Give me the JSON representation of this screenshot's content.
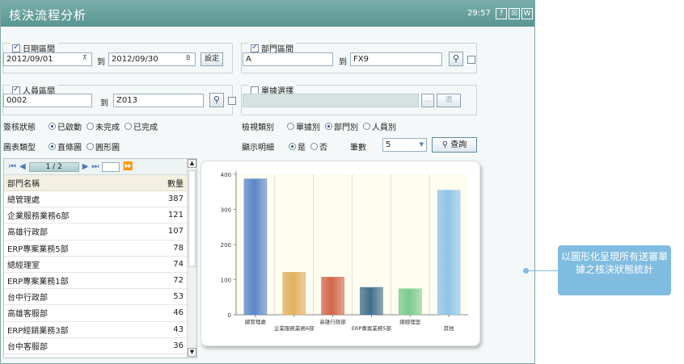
{
  "window": {
    "title": "核決流程分析",
    "clock": "29:57",
    "buttons": [
      "?",
      "☒",
      "W"
    ]
  },
  "date_range": {
    "label": "日期區間",
    "from": "2012/09/01",
    "to_label": "到",
    "to": "2012/09/30",
    "set_label": "設定"
  },
  "dept_range": {
    "label": "部門區間",
    "from": "A",
    "to_label": "到",
    "to": "FX9"
  },
  "person_range": {
    "label": "人員區間",
    "from": "0002",
    "to_label": "到",
    "to": "Z013"
  },
  "form_select": {
    "label": "單據選擇",
    "clear_label": "清"
  },
  "review_status": {
    "label": "簽核狀態",
    "options": [
      "已啟動",
      "未完成",
      "已完成"
    ],
    "selected": 0
  },
  "view_type": {
    "label": "檢視類別",
    "options": [
      "單據別",
      "部門別",
      "人員別"
    ],
    "selected": 1
  },
  "chart_type": {
    "label": "圖表類型",
    "options": [
      "直條圖",
      "圓形圖"
    ],
    "selected": 0
  },
  "show_detail": {
    "label": "顯示明細",
    "options": [
      "是",
      "否"
    ],
    "selected": 0,
    "count_label": "筆數",
    "count_value": "5",
    "query_label": "查詢"
  },
  "grid": {
    "page": "1 / 2",
    "columns": [
      "部門名稱",
      "數量"
    ],
    "rows": [
      [
        "總管理處",
        "387"
      ],
      [
        "企業服務業務6部",
        "121"
      ],
      [
        "高雄行政部",
        "107"
      ],
      [
        "ERP專案業務5部",
        "78"
      ],
      [
        "總經理室",
        "74"
      ],
      [
        "ERP專案業務1部",
        "72"
      ],
      [
        "台中行政部",
        "53"
      ],
      [
        "高雄客服部",
        "46"
      ],
      [
        "ERP經銷業務3部",
        "43"
      ],
      [
        "台中客服部",
        "36"
      ]
    ]
  },
  "chart_data": {
    "type": "bar",
    "categories": [
      "總管理處",
      "企業服務業務6部",
      "高雄行政部",
      "ERP專案業務5部",
      "總經理室",
      "其他"
    ],
    "values": [
      387,
      121,
      107,
      78,
      74,
      355
    ],
    "ylim": [
      0,
      400
    ],
    "yticks": [
      "0",
      "100",
      "200",
      "300",
      "400"
    ],
    "colors": [
      "#5b86c9",
      "#e1b15f",
      "#d2664a",
      "#3f6f8c",
      "#7dc98f",
      "#8fc4e6"
    ]
  },
  "callout": {
    "text": "以圖形化呈現所有送審單據之核決狀態統計"
  }
}
